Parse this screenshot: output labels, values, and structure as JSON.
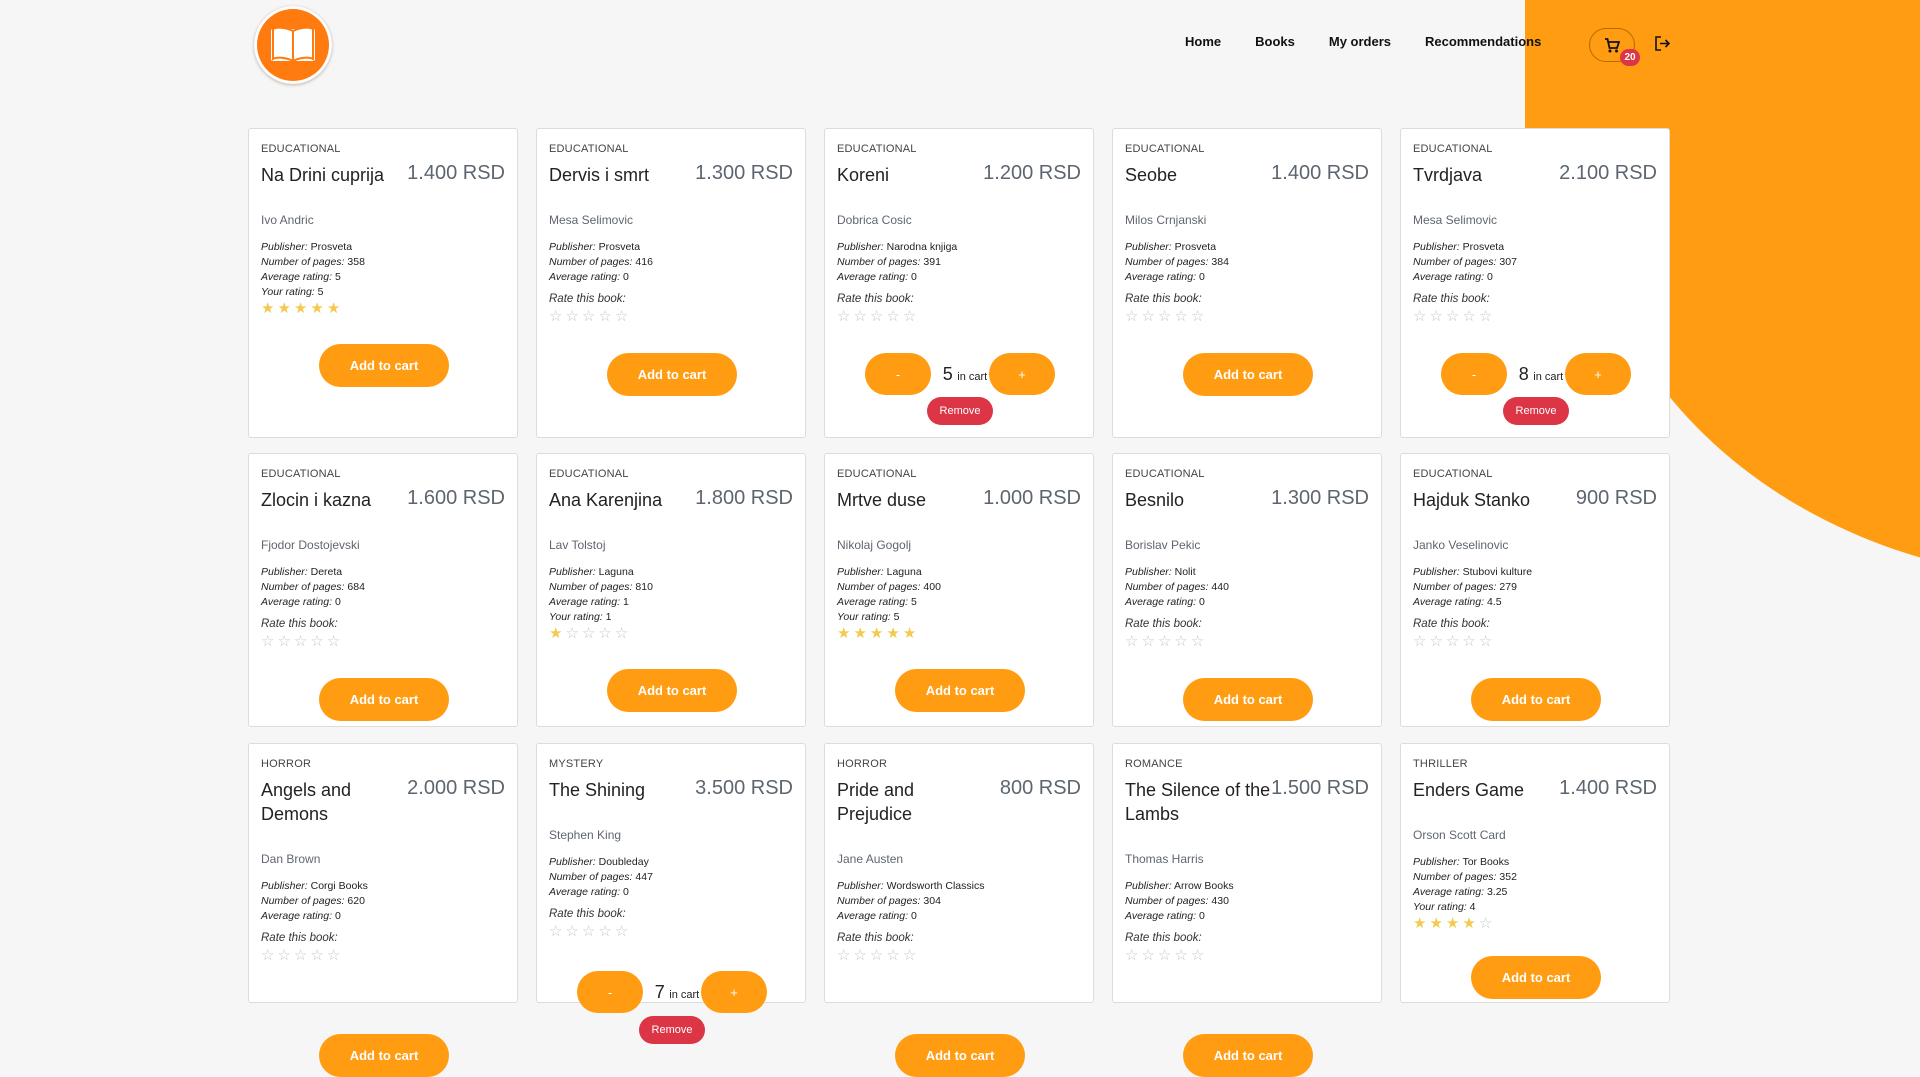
{
  "colors": {
    "accent": "#ff9c11",
    "danger": "#dc3545",
    "star": "#f3c94e"
  },
  "header": {
    "logo_icon": "open-book-icon",
    "nav": [
      {
        "label": "Home"
      },
      {
        "label": "Books"
      },
      {
        "label": "My orders"
      },
      {
        "label": "Recommendations"
      }
    ],
    "cart_count": "20",
    "cart_icon": "cart-icon",
    "logout_icon": "logout-icon"
  },
  "labels": {
    "publisher": "Publisher:",
    "pages": "Number of pages:",
    "avg": "Average rating:",
    "your": "Your rating:",
    "rate_this": "Rate this book:",
    "add_to_cart": "Add to cart",
    "in_cart": "in cart",
    "minus": "-",
    "plus": "+",
    "remove": "Remove"
  },
  "books": [
    {
      "genre": "EDUCATIONAL",
      "title": "Na Drini cuprija",
      "price": "1.400 RSD",
      "author": "Ivo Andric",
      "publisher": "Prosveta",
      "pages": "358",
      "avg": "5",
      "your": "5",
      "stars": 5
    },
    {
      "genre": "EDUCATIONAL",
      "title": "Dervis i smrt",
      "price": "1.300 RSD",
      "author": "Mesa Selimovic",
      "publisher": "Prosveta",
      "pages": "416",
      "avg": "0",
      "your": null,
      "stars": 0
    },
    {
      "genre": "EDUCATIONAL",
      "title": "Koreni",
      "price": "1.200 RSD",
      "author": "Dobrica Cosic",
      "publisher": "Narodna knjiga",
      "pages": "391",
      "avg": "0",
      "your": null,
      "stars": 0,
      "in_cart": "5"
    },
    {
      "genre": "EDUCATIONAL",
      "title": "Seobe",
      "price": "1.400 RSD",
      "author": "Milos Crnjanski",
      "publisher": "Prosveta",
      "pages": "384",
      "avg": "0",
      "your": null,
      "stars": 0
    },
    {
      "genre": "EDUCATIONAL",
      "title": "Tvrdjava",
      "price": "2.100 RSD",
      "author": "Mesa Selimovic",
      "publisher": "Prosveta",
      "pages": "307",
      "avg": "0",
      "your": null,
      "stars": 0,
      "in_cart": "8"
    },
    {
      "genre": "EDUCATIONAL",
      "title": "Zlocin i kazna",
      "price": "1.600 RSD",
      "author": "Fjodor Dostojevski",
      "publisher": "Dereta",
      "pages": "684",
      "avg": "0",
      "your": null,
      "stars": 0
    },
    {
      "genre": "EDUCATIONAL",
      "title": "Ana Karenjina",
      "price": "1.800 RSD",
      "author": "Lav Tolstoj",
      "publisher": "Laguna",
      "pages": "810",
      "avg": "1",
      "your": "1",
      "stars": 1
    },
    {
      "genre": "EDUCATIONAL",
      "title": "Mrtve duse",
      "price": "1.000 RSD",
      "author": "Nikolaj Gogolj",
      "publisher": "Laguna",
      "pages": "400",
      "avg": "5",
      "your": "5",
      "stars": 5
    },
    {
      "genre": "EDUCATIONAL",
      "title": "Besnilo",
      "price": "1.300 RSD",
      "author": "Borislav Pekic",
      "publisher": "Nolit",
      "pages": "440",
      "avg": "0",
      "your": null,
      "stars": 0
    },
    {
      "genre": "EDUCATIONAL",
      "title": "Hajduk Stanko",
      "price": "900 RSD",
      "author": "Janko Veselinovic",
      "publisher": "Stubovi kulture",
      "pages": "279",
      "avg": "4.5",
      "your": null,
      "stars": 0
    },
    {
      "genre": "HORROR",
      "title": "Angels and Demons",
      "price": "2.000 RSD",
      "author": "Dan Brown",
      "publisher": "Corgi Books",
      "pages": "620",
      "avg": "0",
      "your": null,
      "stars": 0
    },
    {
      "genre": "MYSTERY",
      "title": "The Shining",
      "price": "3.500 RSD",
      "author": "Stephen King",
      "publisher": "Doubleday",
      "pages": "447",
      "avg": "0",
      "your": null,
      "stars": 0,
      "in_cart": "7"
    },
    {
      "genre": "HORROR",
      "title": "Pride and Prejudice",
      "price": "800 RSD",
      "author": "Jane Austen",
      "publisher": "Wordsworth Classics",
      "pages": "304",
      "avg": "0",
      "your": null,
      "stars": 0
    },
    {
      "genre": "ROMANCE",
      "title": "The Silence of the Lambs",
      "price": "1.500 RSD",
      "author": "Thomas Harris",
      "publisher": "Arrow Books",
      "pages": "430",
      "avg": "0",
      "your": null,
      "stars": 0
    },
    {
      "genre": "THRILLER",
      "title": "Enders Game",
      "price": "1.400 RSD",
      "author": "Orson Scott Card",
      "publisher": "Tor Books",
      "pages": "352",
      "avg": "3.25",
      "your": "4",
      "stars": 4
    }
  ]
}
